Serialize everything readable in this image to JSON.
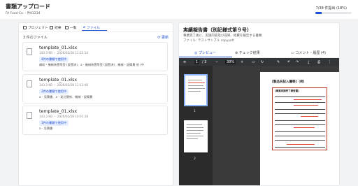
{
  "header": {
    "title": "書類アップロード",
    "subtitle": "FA Food Co. - 件01234",
    "progress_text": "7/38 件提出 (18%)",
    "progress_fraction": 0.18
  },
  "left_panel": {
    "tabs": [
      {
        "label": "プロジェクト",
        "icon": "building-icon",
        "active": false
      },
      {
        "label": "結果",
        "icon": "grid-icon",
        "active": false
      },
      {
        "label": "一覧",
        "icon": "list-icon",
        "active": false
      },
      {
        "label": "ファイル",
        "icon": "clip-icon",
        "active": true
      }
    ],
    "file_count": "3 件のファイル",
    "refresh_label": "更新",
    "files": [
      {
        "name": "template_01.xlsx",
        "meta": "143.3 KB ・ 2026/02/28 11:23:14",
        "badge": "4件の書類で使用中",
        "usage": "補助・機械装置等受 (設置済)、a - 機械装置等受 (設置済)、機械・設備費 他 (中"
      },
      {
        "name": "template_01.xlsx",
        "meta": "143.3 KB ・ 2026/02/28 11:13:46",
        "badge": "2件の書類で使用中",
        "usage": "a - 見積書、a - 発注関係、機械・設備費"
      },
      {
        "name": "template_01.xlsx",
        "meta": "143.3 KB ・ 2026/02/28 10:01:38",
        "badge": "1件の書類で使用中",
        "usage": "a - 見積書"
      }
    ]
  },
  "right_panel": {
    "title": "実績報告書（別記様式第９号）",
    "description": "事業完了後に、実施内容及び成果、経費を報告する書類",
    "file_line": "ファイル: テストサンプル copy.pdf",
    "tabs": [
      {
        "label": "◎ プレビュー",
        "active": true
      },
      {
        "label": "チェック結果",
        "active": false
      },
      {
        "label": "コメント・履歴 (4)",
        "active": false
      }
    ]
  },
  "viewer": {
    "page_input": "1",
    "page_total": "/ 3",
    "zoom": "39%",
    "thumb_labels": [
      "1",
      "2"
    ],
    "document_title": "[製品名記入欄等]（例）",
    "form_title": "[事業実施完了報告書]"
  },
  "colors": {
    "accent": "#1e4fd0",
    "badge_bg": "#e8efff",
    "viewer_bg": "#3a3a3a"
  }
}
